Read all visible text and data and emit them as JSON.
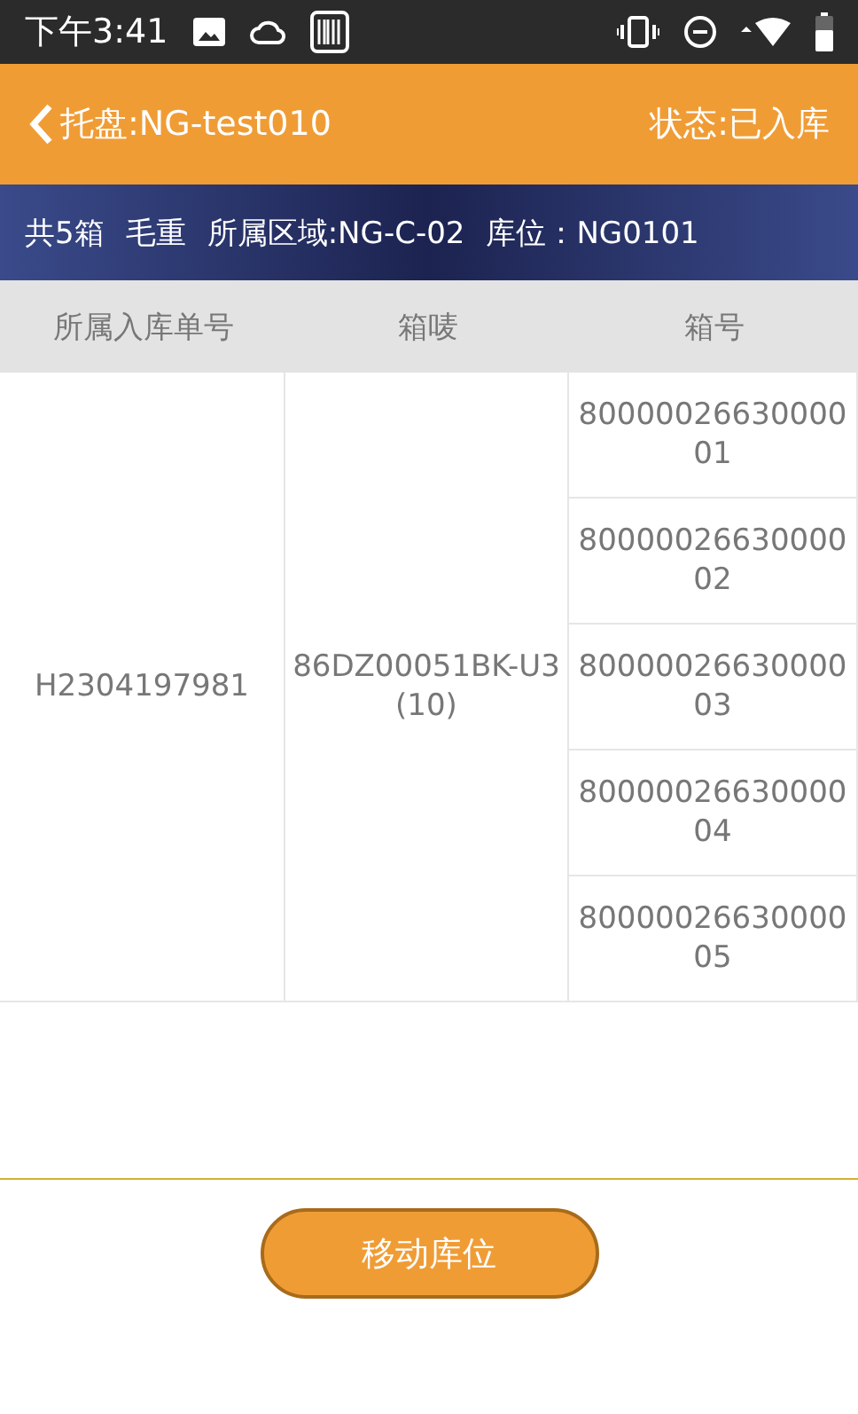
{
  "status_bar": {
    "time": "下午3:41"
  },
  "header": {
    "title": "托盘:NG-test010",
    "status": "状态:已入库"
  },
  "summary": [
    "共5箱",
    "毛重",
    "所属区域:NG-C-02",
    "库位：NG0101"
  ],
  "table": {
    "columns": [
      "所属入库单号",
      "箱唛",
      "箱号"
    ],
    "groups": [
      {
        "order": "H2304197981",
        "mark": "86DZ00051BK-U3(10)",
        "boxes": [
          "8000002663000001",
          "8000002663000002",
          "8000002663000003",
          "8000002663000004",
          "8000002663000005"
        ]
      }
    ]
  },
  "action": {
    "label": "移动库位"
  }
}
